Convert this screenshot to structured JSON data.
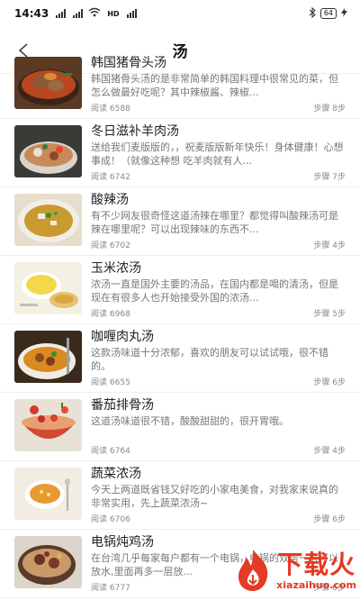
{
  "status_bar": {
    "time": "14:43",
    "network_label": "HD",
    "battery": "64"
  },
  "header": {
    "title": "汤"
  },
  "meta_labels": {
    "read": "阅读",
    "steps": "步骤"
  },
  "recipes": [
    {
      "title": "韩国猪骨头汤",
      "desc": "韩国猪骨头汤的是非常简单的韩国料理中很常见的菜，但怎么做最好吃呢？其中辣椒酱、辣椒...",
      "reads": "6588",
      "steps": "8步",
      "image": "korean-pork-bone-soup-photo"
    },
    {
      "title": "冬日滋补羊肉汤",
      "desc": "送给我们麦版版的，，祝麦版版新年快乐！身体健康！心想事成！（就像这种想 吃羊肉就有人...",
      "reads": "6742",
      "steps": "7步",
      "image": "mutton-soup-photo"
    },
    {
      "title": "酸辣汤",
      "desc": "有不少网友很奇怪这道汤辣在哪里？都觉得叫酸辣汤可是辣在哪里呢？可以出现辣味的东西不...",
      "reads": "6702",
      "steps": "4步",
      "image": "hot-sour-soup-photo"
    },
    {
      "title": "玉米浓汤",
      "desc": "浓汤一直是国外主要的汤品，在国内都是喝的清汤，但是现在有很多人也开始接受外国的浓汤...",
      "reads": "6968",
      "steps": "5步",
      "image": "corn-soup-photo"
    },
    {
      "title": "咖喱肉丸汤",
      "desc": "这款汤味道十分浓郁，喜欢的朋友可以试试哦，很不错的。",
      "reads": "6655",
      "steps": "6步",
      "image": "curry-meatball-soup-photo"
    },
    {
      "title": "番茄排骨汤",
      "desc": "这道汤味道很不错，酸酸甜甜的，很开胃哦。",
      "reads": "6764",
      "steps": "4步",
      "image": "tomato-rib-soup-photo"
    },
    {
      "title": "蔬菜浓汤",
      "desc": "今天上两道既省钱又好吃的小家电美食，对我家来说真的非常实用，先上蔬菜浓汤~",
      "reads": "6706",
      "steps": "6步",
      "image": "vegetable-soup-photo"
    },
    {
      "title": "电锅炖鸡汤",
      "desc": "在台湾几乎每家每户都有一个电锅，电锅的双层一层可以放水,里面再多一层放...",
      "reads": "6777",
      "steps": "6步",
      "image": "chicken-soup-photo"
    }
  ],
  "watermark": {
    "brand": "下载火",
    "domain": "xiazaihuo.com"
  },
  "colors": {
    "accent": "#e53a24",
    "text": "#222222",
    "muted": "#777777"
  }
}
